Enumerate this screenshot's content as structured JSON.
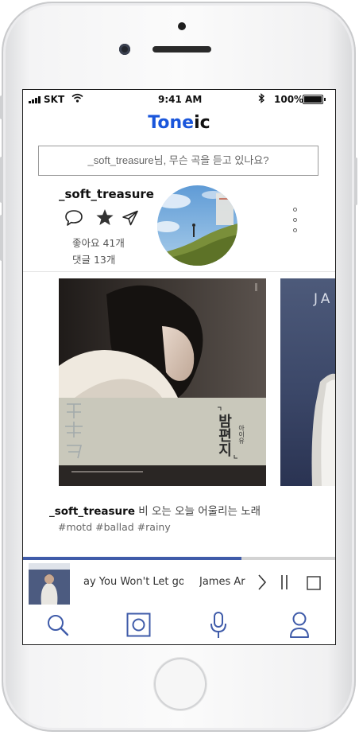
{
  "status_bar": {
    "carrier": "SKT",
    "time": "9:41 AM",
    "battery": "100%",
    "icons": [
      "signal-icon",
      "wifi-icon",
      "bluetooth-icon",
      "battery-icon"
    ]
  },
  "app": {
    "logo_part1": "Tone",
    "logo_part2": "ic",
    "colors": {
      "logo_blue": "#1a56db",
      "accent": "#3f5ba9"
    }
  },
  "search": {
    "placeholder": "_soft_treasure님, 무슨 곡을 듣고 있나요?"
  },
  "post": {
    "username": "_soft_treasure",
    "actions": [
      "comment-icon",
      "star-icon",
      "share-icon"
    ],
    "likes": "좋아요 41개",
    "comments": "댓글 13개",
    "album_cover_text": "밤편지",
    "album_cover_artist": "아이유",
    "second_cover_text": "JA",
    "caption_user": "_soft_treasure",
    "caption_text": " 비 오는 오늘 어울리는 노래",
    "tags": "#motd #ballad #rainy"
  },
  "player": {
    "song": "ay You Won't Let go",
    "artist": "James Ar",
    "progress": 0.7,
    "controls": [
      "next-icon",
      "pause-icon",
      "stop-icon"
    ]
  },
  "tabbar": {
    "tabs": [
      "search-icon",
      "album-icon",
      "microphone-icon",
      "profile-icon"
    ]
  }
}
